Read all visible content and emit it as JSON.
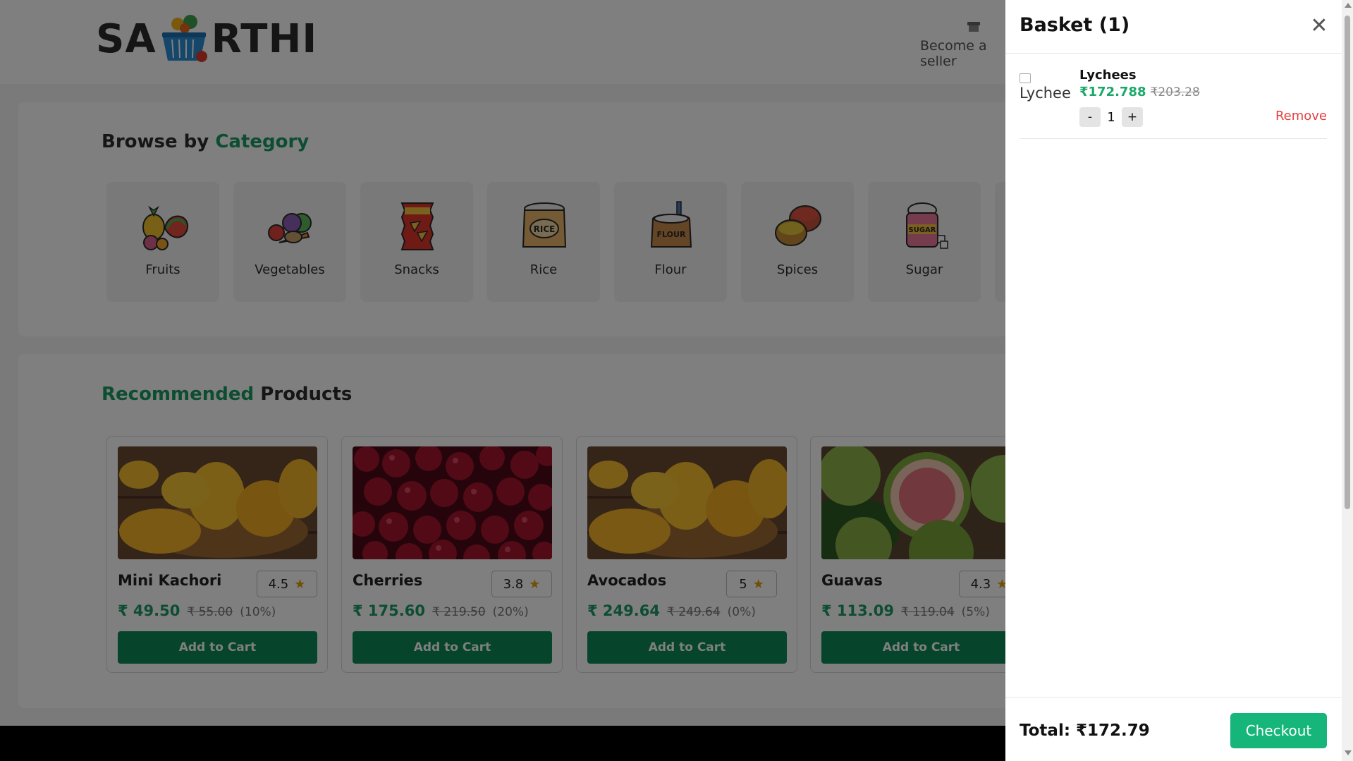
{
  "header": {
    "logo_left": "SA",
    "logo_right": "RTHI",
    "seller_label": "Become a seller"
  },
  "categories": {
    "title_prefix": "Browse by",
    "title_accent": "Category",
    "items": [
      {
        "label": "Fruits",
        "icon": "fruits-icon"
      },
      {
        "label": "Vegetables",
        "icon": "vegetables-icon"
      },
      {
        "label": "Snacks",
        "icon": "snacks-icon"
      },
      {
        "label": "Rice",
        "icon": "rice-icon"
      },
      {
        "label": "Flour",
        "icon": "flour-icon"
      },
      {
        "label": "Spices",
        "icon": "spices-icon"
      },
      {
        "label": "Sugar",
        "icon": "sugar-icon"
      }
    ]
  },
  "products": {
    "title_accent": "Recommended",
    "title_suffix": "Products",
    "add_label": "Add to Cart",
    "items": [
      {
        "name": "Mini Kachori",
        "rating": "4.5",
        "price": "₹ 49.50",
        "old_price": "₹ 55.00",
        "discount": "(10%)",
        "image": "mangoes"
      },
      {
        "name": "Cherries",
        "rating": "3.8",
        "price": "₹ 175.60",
        "old_price": "₹ 219.50",
        "discount": "(20%)",
        "image": "cherries"
      },
      {
        "name": "Avocados",
        "rating": "5",
        "price": "₹ 249.64",
        "old_price": "₹ 249.64",
        "discount": "(0%)",
        "image": "mangoes"
      },
      {
        "name": "Guavas",
        "rating": "4.3",
        "price": "₹ 113.09",
        "old_price": "₹ 119.04",
        "discount": "(5%)",
        "image": "guavas"
      }
    ]
  },
  "basket": {
    "title": "Basket (1)",
    "close_icon": "close-icon",
    "items": [
      {
        "image_alt": "Lychee",
        "name": "Lychees",
        "price": "₹172.788",
        "old_price": "₹203.28",
        "qty": "1",
        "minus": "-",
        "plus": "+",
        "remove": "Remove"
      }
    ],
    "total": "Total: ₹172.79",
    "checkout": "Checkout"
  },
  "colors": {
    "accent": "#1a9b62",
    "button": "#0d8a56",
    "checkout": "#16b57a",
    "remove": "#e53e3e",
    "star": "#e0a106"
  }
}
